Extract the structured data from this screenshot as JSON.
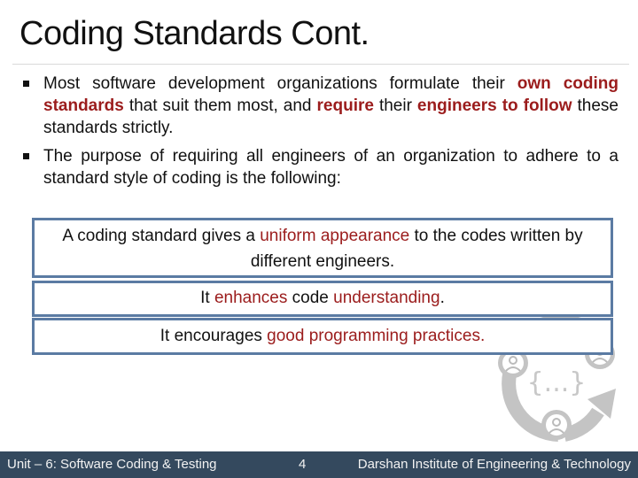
{
  "slide": {
    "title": "Coding Standards Cont.",
    "bullets": [
      {
        "parts": [
          {
            "text": "Most software development organizations formulate their ",
            "style": "normal"
          },
          {
            "text": "own coding standards",
            "style": "bold-red"
          },
          {
            "text": " that suit them most, and ",
            "style": "normal"
          },
          {
            "text": "require",
            "style": "bold-red"
          },
          {
            "text": " their ",
            "style": "normal"
          },
          {
            "text": "engineers to follow",
            "style": "bold-red"
          },
          {
            "text": " these standards strictly.",
            "style": "normal"
          }
        ]
      },
      {
        "parts": [
          {
            "text": "The purpose of requiring all engineers of an organization to adhere to a standard style of coding is the following:",
            "style": "normal"
          }
        ]
      }
    ],
    "boxes": [
      {
        "parts": [
          {
            "text": "A coding standard gives a ",
            "style": "normal"
          },
          {
            "text": "uniform appearance",
            "style": "red"
          },
          {
            "text": " to the codes written by different engineers.",
            "style": "normal"
          }
        ]
      },
      {
        "parts": [
          {
            "text": "It ",
            "style": "normal"
          },
          {
            "text": "enhances",
            "style": "red"
          },
          {
            "text": " code ",
            "style": "normal"
          },
          {
            "text": "understanding",
            "style": "red"
          },
          {
            "text": ".",
            "style": "normal"
          }
        ]
      },
      {
        "parts": [
          {
            "text": "It encourages ",
            "style": "normal"
          },
          {
            "text": "good programming practices.",
            "style": "red"
          }
        ]
      }
    ],
    "graphic": {
      "icon": "code-collaboration-cycle-icon",
      "braces_text": "{...}"
    },
    "colors": {
      "accent_red": "#9b1c1c",
      "box_border": "#5b7ba3",
      "footer_bg": "#34495e"
    }
  },
  "footer": {
    "unit": "Unit – 6: Software Coding & Testing",
    "page_number": "4",
    "institute": "Darshan Institute of Engineering & Technology"
  }
}
